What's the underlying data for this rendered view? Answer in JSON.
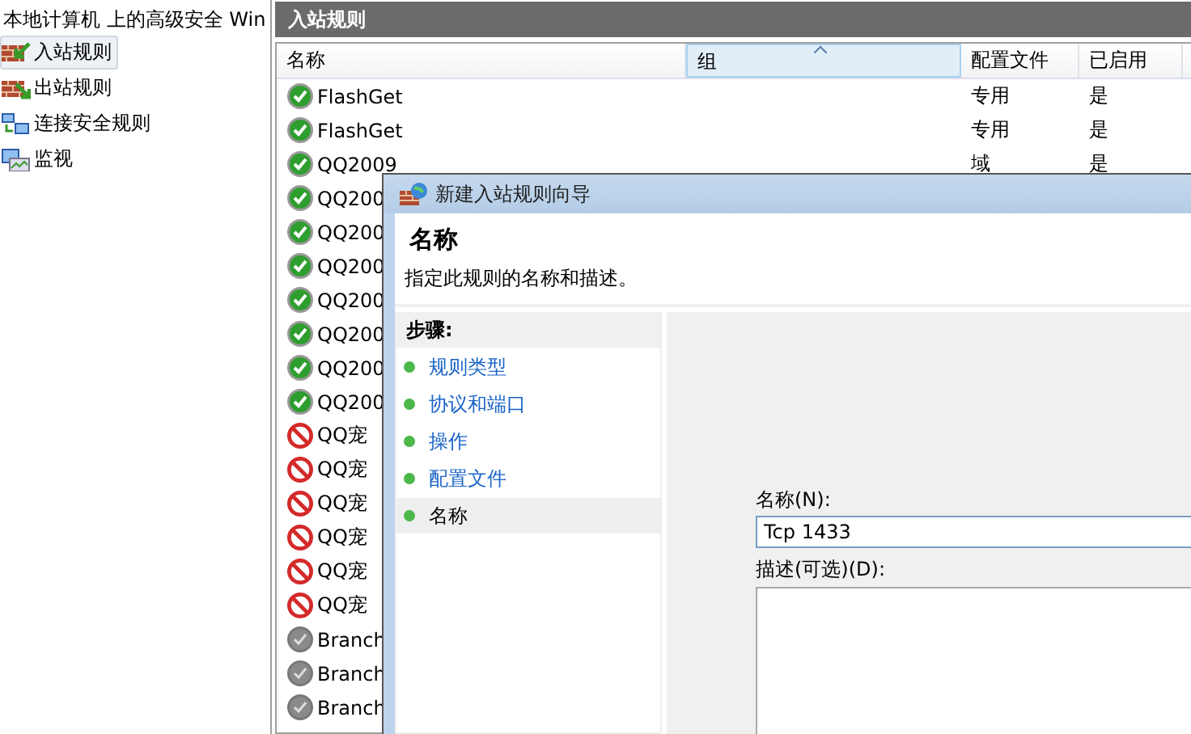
{
  "tree": {
    "root": "本地计算机 上的高级安全 Win",
    "items": [
      {
        "label": "入站规则",
        "kind": "inbound",
        "selected": true
      },
      {
        "label": "出站规则",
        "kind": "outbound",
        "selected": false
      },
      {
        "label": "连接安全规则",
        "kind": "security",
        "selected": false
      },
      {
        "label": "监视",
        "kind": "monitor",
        "selected": false
      }
    ]
  },
  "panel": {
    "title": "入站规则"
  },
  "table": {
    "columns": [
      {
        "label": "名称",
        "sorted": false
      },
      {
        "label": "组",
        "sorted": true
      },
      {
        "label": "配置文件",
        "sorted": false
      },
      {
        "label": "已启用",
        "sorted": false
      }
    ],
    "rows": [
      {
        "kind": "allow",
        "name": "FlashGet",
        "profile": "专用",
        "enabled": "是"
      },
      {
        "kind": "allow",
        "name": "FlashGet",
        "profile": "专用",
        "enabled": "是"
      },
      {
        "kind": "allow",
        "name": "QQ2009",
        "profile": "域",
        "enabled": "是"
      },
      {
        "kind": "allow",
        "name": "QQ200"
      },
      {
        "kind": "allow",
        "name": "QQ200"
      },
      {
        "kind": "allow",
        "name": "QQ200"
      },
      {
        "kind": "allow",
        "name": "QQ200"
      },
      {
        "kind": "allow",
        "name": "QQ200"
      },
      {
        "kind": "allow",
        "name": "QQ200"
      },
      {
        "kind": "allow",
        "name": "QQ200"
      },
      {
        "kind": "block",
        "name": "QQ宠"
      },
      {
        "kind": "block",
        "name": "QQ宠"
      },
      {
        "kind": "block",
        "name": "QQ宠"
      },
      {
        "kind": "block",
        "name": "QQ宠"
      },
      {
        "kind": "block",
        "name": "QQ宠"
      },
      {
        "kind": "block",
        "name": "QQ宠"
      },
      {
        "kind": "disabled",
        "name": "Branch"
      },
      {
        "kind": "disabled",
        "name": "Branch"
      },
      {
        "kind": "disabled",
        "name": "Branch"
      }
    ]
  },
  "dialog": {
    "title": "新建入站规则向导",
    "heading": "名称",
    "subtitle": "指定此规则的名称和描述。",
    "steps_title": "步骤:",
    "steps": [
      {
        "label": "规则类型",
        "selected": false
      },
      {
        "label": "协议和端口",
        "selected": false
      },
      {
        "label": "操作",
        "selected": false
      },
      {
        "label": "配置文件",
        "selected": false
      },
      {
        "label": "名称",
        "selected": true
      }
    ],
    "name_label": "名称(N):",
    "name_value": "Tcp 1433",
    "desc_label": "描述(可选)(D):"
  }
}
